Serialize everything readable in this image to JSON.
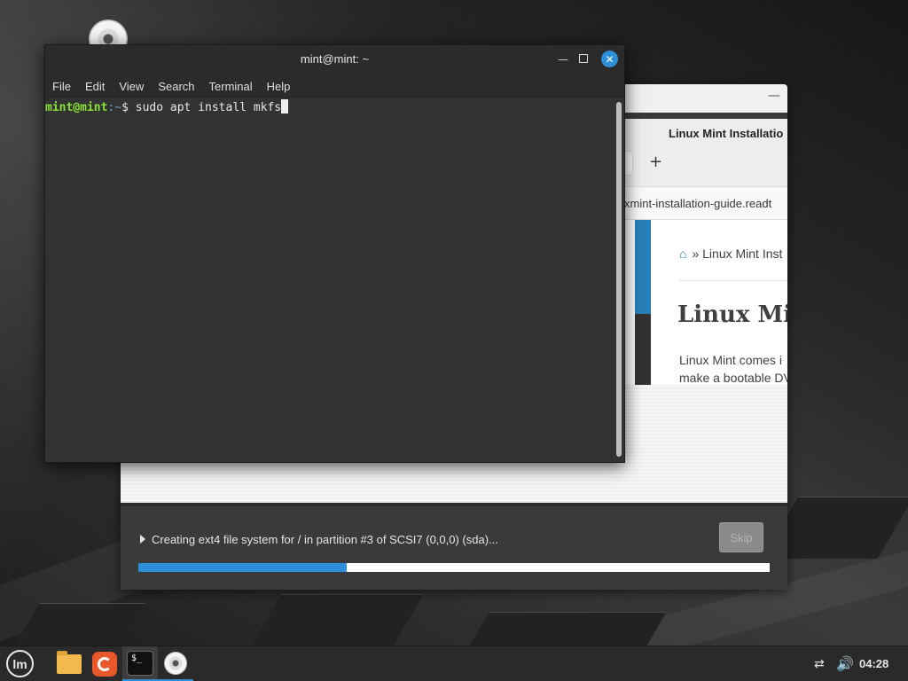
{
  "terminal": {
    "title": "mint@mint: ~",
    "menu": [
      "File",
      "Edit",
      "View",
      "Search",
      "Terminal",
      "Help"
    ],
    "prompt_user": "mint@mint",
    "prompt_path": ":~",
    "prompt_symbol": "$ ",
    "command": "sudo apt install mkfs"
  },
  "installer": {
    "status_text": "Creating ext4 file system for / in partition #3 of SCSI7 (0,0,0) (sda)...",
    "skip_label": "Skip",
    "progress_fraction": 0.33,
    "accent_color": "#2d8fd8"
  },
  "browser": {
    "title": "Linux Mint Installatio",
    "url": "xmint-installation-guide.readt",
    "breadcrumb": "» Linux Mint Inst",
    "heading": "Linux Min",
    "para_line1": "Linux Mint comes i",
    "para_line2": "make a bootable DV",
    "new_tab": "+"
  },
  "taskbar": {
    "clock": "04:28",
    "icons": [
      "mint-menu-icon",
      "folder-icon",
      "firefox-icon",
      "terminal-icon",
      "disc-icon",
      "network-icon",
      "volume-icon"
    ]
  }
}
